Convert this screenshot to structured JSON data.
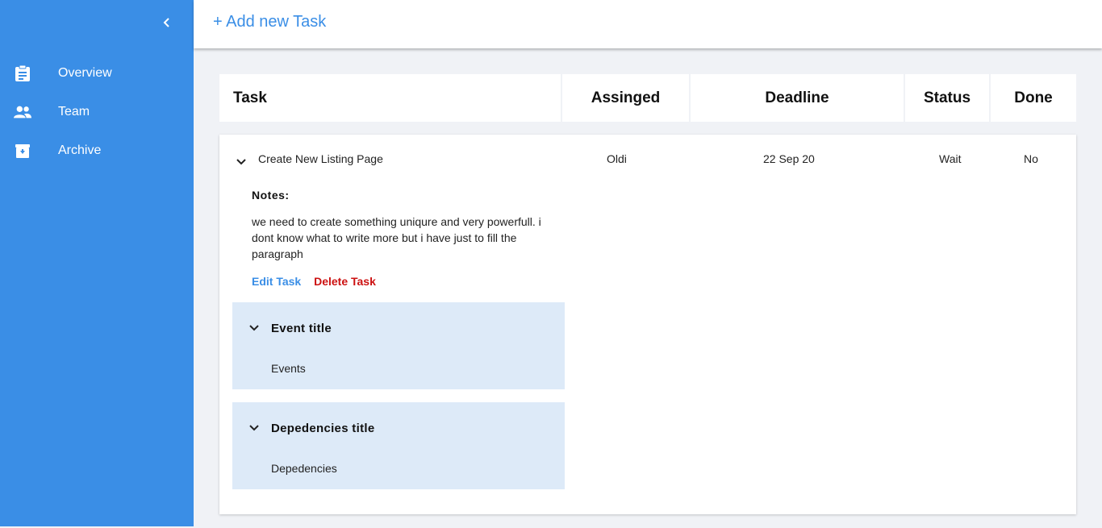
{
  "sidebar": {
    "items": [
      {
        "label": "Overview",
        "icon": "clipboard-icon"
      },
      {
        "label": "Team",
        "icon": "people-icon"
      },
      {
        "label": "Archive",
        "icon": "archive-icon"
      }
    ]
  },
  "topbar": {
    "add_task_label": "+ Add new Task"
  },
  "table": {
    "headers": {
      "task": "Task",
      "assigned": "Assinged",
      "deadline": "Deadline",
      "status": "Status",
      "done": "Done"
    },
    "rows": [
      {
        "task": "Create New Listing Page",
        "assigned": "Oldi",
        "deadline": "22 Sep 20",
        "status": "Wait",
        "done": "No",
        "notes_label": "Notes:",
        "notes": "we need to create something uniqure and very powerfull. i dont know what to write more but i have just to fill the paragraph",
        "edit_label": "Edit Task",
        "delete_label": "Delete Task",
        "events": {
          "title": "Event title",
          "body": "Events"
        },
        "dependencies": {
          "title": "Depedencies title",
          "body": "Depedencies"
        }
      }
    ]
  },
  "colors": {
    "sidebar": "#3a8ee6",
    "accent": "#3a8ee6",
    "danger": "#cc1111",
    "panel": "#ddeaf8",
    "background": "#f0f2f6"
  }
}
